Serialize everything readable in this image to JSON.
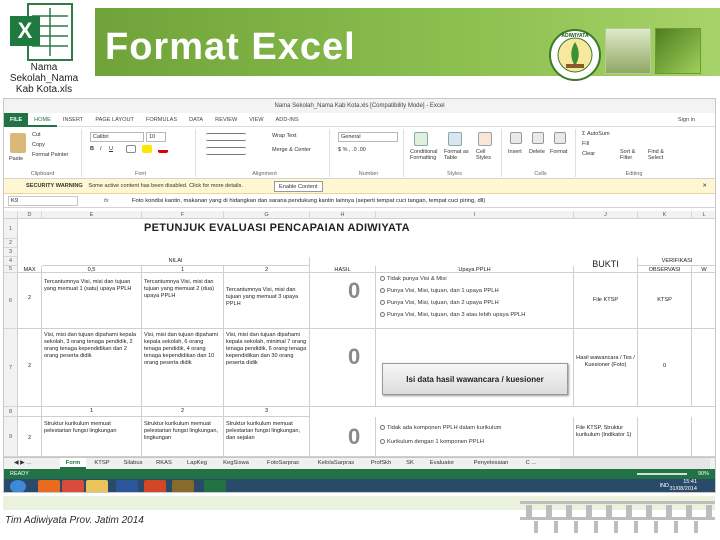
{
  "slide": {
    "title": "Format Excel",
    "icon_caption": "Nama Sekolah_Nama Kab Kota.xls",
    "footer": "Tim Adiwiyata Prov. Jatim 2014",
    "logo_lettering": "ADIWIYATA"
  },
  "excel": {
    "window_title": "Nama Sekolah_Nama Kab Kota.xls  [Compatibility Mode] - Excel",
    "tabs": [
      "FILE",
      "HOME",
      "INSERT",
      "PAGE LAYOUT",
      "FORMULAS",
      "DATA",
      "REVIEW",
      "VIEW",
      "ADD-INS"
    ],
    "sign_in": "Sign in",
    "ribbon": {
      "paste": "Paste",
      "cut": "Cut",
      "copy": "Copy",
      "format_painter": "Format Painter",
      "font_name": "Calibri",
      "font_size": "10",
      "wrap_text": "Wrap Text",
      "merge_center": "Merge & Center",
      "number_format": "General",
      "conditional_formatting": "Conditional Formatting",
      "format_as_table": "Format as Table",
      "cell_styles": "Cell Styles",
      "insert": "Insert",
      "delete": "Delete",
      "format": "Format",
      "autosum": "AutoSum",
      "fill": "Fill",
      "clear": "Clear",
      "sort_filter": "Sort & Filter",
      "find_select": "Find & Select",
      "groups": [
        "Clipboard",
        "Font",
        "Alignment",
        "Number",
        "Styles",
        "Cells",
        "Editing"
      ]
    },
    "security_bar": {
      "label": "SECURITY WARNING",
      "message": "Some active content has been disabled. Click for more details.",
      "button": "Enable Content"
    },
    "formula_bar": {
      "name_box": "K9",
      "fx": "fx",
      "formula": "Foto kondisi kantin, makanan yang di hidangkan dan sarana pendukung kantin lainnya (seperti tempat cuci tangan, tempat cuci piring, dll)"
    },
    "columns": [
      "D",
      "E",
      "F",
      "G",
      "H",
      "I",
      "J",
      "K",
      "L"
    ],
    "sheet": {
      "title": "PETUNJUK  EVALUASI PENCAPAIAN ADIWIYATA",
      "nilai_label": "NILAI",
      "hasil_label": "HASIL",
      "upaya_label": "Upaya PPLH",
      "bukti_label": "BUKTI",
      "verifikasi_label": "VERIFIKASI",
      "observasi_label": "OBSERVASI",
      "wa_label": "W",
      "max_label": "MAX",
      "score_headers": [
        "0,5",
        "1",
        "2",
        "3"
      ],
      "row_numbers": [
        "1",
        "2",
        "3",
        "4",
        "5",
        "6",
        "7",
        "8",
        "9"
      ],
      "rows": [
        {
          "max": "2",
          "c1": "Tercantumnya Visi, misi dan tujuan yang memuat 1 (satu) upaya PPLH",
          "c2": "Tercantumnya Visi, misi dan tujuan yang memuat 2 (dua) upaya PPLH",
          "c3": "Tercantumnya Visi, misi dan tujuan yang memuat 3 upaya PPLH",
          "hasil": "0",
          "options": [
            "Tidak punya Visi & Misi",
            "Punya Visi, Misi, tujuan, dan 1 upaya PPLH",
            "Punya Visi, Misi, tujuan, dan 2 upaya PPLH",
            "Punya Visi, Misi, tujuan, dan 3 atau lebih upaya PPLH"
          ],
          "bukti": "File KTSP",
          "observasi": "KTSP"
        },
        {
          "max": "2",
          "c1": "Visi, misi dan tujuan dipahami kepala sekolah, 3 orang tenaga pendidik, 2 orang tenaga kependidikan dan 2 orang peserta didik",
          "c2": "Visi, misi dan tujuan dipahami kepala sekolah, 6 orang tenaga pendidik, 4 orang tenaga kependidikan dan 10 orang peserta didik",
          "c3": "Visi, misi dan tujuan dipahami kepala sekolah, minimal 7 orang tenaga pendidik, 6 orang tenaga kependidikan dan 30 orang peserta didik",
          "hasil": "0",
          "button": "Isi data hasil wawancara / kuesioner",
          "bukti": "Hasil wawancara / Tes / Kuesioner (Foto)",
          "observasi": "0"
        },
        {
          "max": "2",
          "c1": "Struktur kurikulum memuat pelestarian fungsi lingkungan",
          "c2": "Struktur kurikulum memuat pelestarian fungsi lingkungan, lingkungan",
          "c3": "Struktur kurikulum memuat pelestarian fungsi lingkungan, dan sejalan",
          "hasil": "0",
          "options": [
            "Tidak ada komponen PPLH dalam kurikulum",
            "Kurikulum dengan 1 komponen PPLH"
          ],
          "bukti": "File KTSP, Struktur kurikulum (Indikator 1)"
        }
      ]
    },
    "sheet_tabs": [
      "Form",
      "KTSP",
      "Silabus",
      "RKAS",
      "LapKeg",
      "KegSiswa",
      "FotoSarpras",
      "KelolaSarpras",
      "ProfSkh",
      "SK",
      "Evaluator",
      "Penyelesaian",
      "C ..."
    ],
    "status": {
      "ready": "READY",
      "zoom": "90%"
    },
    "taskbar": {
      "ind": "IND",
      "time": "15:41",
      "date": "31/08/2014"
    }
  },
  "colors": {
    "header_green": "#8cc04f",
    "excel_green": "#217346",
    "security_bar": "#fff7d1"
  }
}
